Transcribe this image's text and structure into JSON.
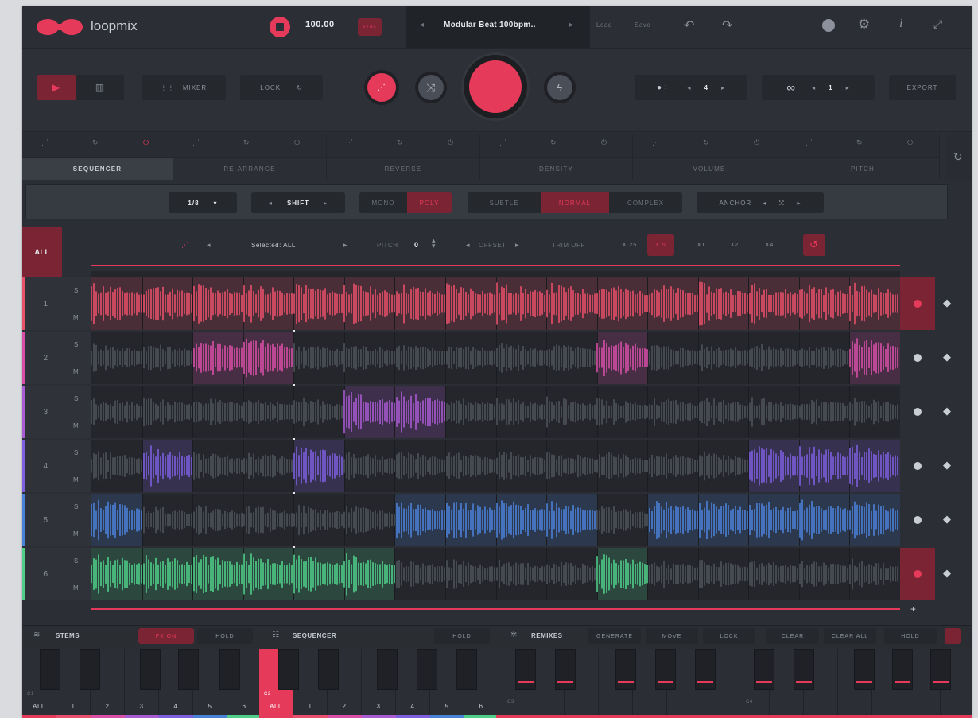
{
  "app": {
    "name": "loopmix"
  },
  "header": {
    "bpm": "100.00",
    "sync": "SYNC",
    "preset": "Modular Beat 100bpm..",
    "load": "Load",
    "save": "Save"
  },
  "controls": {
    "mixer": "MIXER",
    "lock": "LOCK",
    "density_value": "4",
    "loop_value": "1",
    "export": "EXPORT"
  },
  "tabs": [
    "SEQUENCER",
    "RE-ARRANGE",
    "REVERSE",
    "DENSITY",
    "VOLUME",
    "PITCH"
  ],
  "options": {
    "division": "1/8",
    "shift": "SHIFT",
    "mono": "MONO",
    "poly": "POLY",
    "subtle": "SUBTLE",
    "normal": "NORMAL",
    "complex": "COMPLEX",
    "anchor": "ANCHOR"
  },
  "selection": {
    "all": "ALL",
    "selected": "Selected: ALL",
    "pitch": "PITCH",
    "pitch_value": "0",
    "offset": "OFFSET",
    "trim": "TRIM OFF",
    "speeds": [
      "X.25",
      "X.5",
      "X1",
      "X2",
      "X4"
    ]
  },
  "tracks": [
    {
      "num": "1",
      "s": "S",
      "m": "M",
      "color": "#e8506b"
    },
    {
      "num": "2",
      "s": "S",
      "m": "M",
      "color": "#d94fa8"
    },
    {
      "num": "3",
      "s": "S",
      "m": "M",
      "color": "#a95bd3"
    },
    {
      "num": "4",
      "s": "S",
      "m": "M",
      "color": "#7d5fe0"
    },
    {
      "num": "5",
      "s": "S",
      "m": "M",
      "color": "#4a82d9"
    },
    {
      "num": "6",
      "s": "S",
      "m": "M",
      "color": "#4fcf8a"
    }
  ],
  "bottom": {
    "stems": "STEMS",
    "fx_on": "FX ON",
    "hold": "HOLD",
    "sequencer": "SEQUENCER",
    "seq_hold": "HOLD",
    "remixes": "REMIXES",
    "generate": "GENERATE",
    "move": "MOVE",
    "lock": "LOCK",
    "clear": "CLEAR",
    "clear_all": "CLEAR ALL",
    "remix_hold": "HOLD"
  },
  "keys": {
    "stems_octave": "C1",
    "stems": [
      "ALL",
      "1",
      "2",
      "3",
      "4",
      "5",
      "6"
    ],
    "seq_octave": "C2",
    "seq": [
      "ALL",
      "1",
      "2",
      "3",
      "4",
      "5",
      "6"
    ],
    "remix_c3": "C3",
    "remix_c4": "C4"
  },
  "colors": {
    "accent": "#e63a5a",
    "bg": "#2b2e34"
  }
}
